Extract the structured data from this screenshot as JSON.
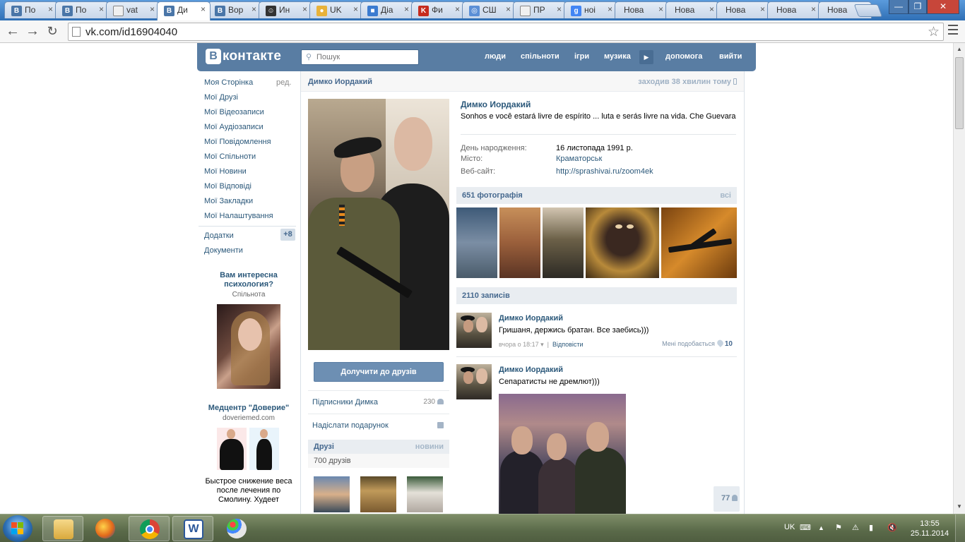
{
  "browser": {
    "tabs": [
      {
        "title": "По",
        "icon": "vk-icon"
      },
      {
        "title": "По",
        "icon": "vk-icon"
      },
      {
        "title": "vat",
        "icon": "page-icon"
      },
      {
        "title": "Ди",
        "icon": "vk-icon",
        "active": true
      },
      {
        "title": "Вор",
        "icon": "vk-icon"
      },
      {
        "title": "Ин",
        "icon": "user-icon"
      },
      {
        "title": "UK",
        "icon": "coin-icon"
      },
      {
        "title": "Діа",
        "icon": "chat-icon"
      },
      {
        "title": "Фи",
        "icon": "k-icon"
      },
      {
        "title": "СШ",
        "icon": "globe-icon"
      },
      {
        "title": "ПР",
        "icon": "page-icon"
      },
      {
        "title": "ноі",
        "icon": "google-icon"
      },
      {
        "title": "Нова",
        "icon": ""
      },
      {
        "title": "Нова",
        "icon": ""
      },
      {
        "title": "Нова",
        "icon": ""
      },
      {
        "title": "Нова",
        "icon": ""
      },
      {
        "title": "Нова",
        "icon": ""
      }
    ],
    "url": "vk.com/id16904040"
  },
  "vk": {
    "logo_letter": "B",
    "logo_text": "контакте",
    "search_placeholder": "Пошук",
    "nav": [
      "люди",
      "спільноти",
      "ігри",
      "музика",
      "допомога",
      "вийти"
    ],
    "left_menu": {
      "edit": "ред.",
      "items": [
        "Моя Сторінка",
        "Мої Друзі",
        "Мої Відеозаписи",
        "Мої Аудіозаписи",
        "Мої Повідомлення",
        "Мої Спільноти",
        "Мої Новини",
        "Мої Відповіді",
        "Мої Закладки",
        "Мої Налаштування"
      ],
      "extra": [
        "Додатки",
        "Документи"
      ],
      "apps_badge": "+8"
    },
    "ads": [
      {
        "title": "Вам интересна психология?",
        "subtitle": "Спільнота"
      },
      {
        "title": "Медцентр \"Доверие\"",
        "subtitle": "doveriemed.com",
        "text": "Быстрое снижение веса после лечения по Смолину. Худеет"
      }
    ],
    "profile": {
      "name": "Димко Иордакий",
      "last_seen": "заходив 38 хвилин тому",
      "status": "Sonhos e você estará livre de espírito ... luta e serás livre na vida. Che Guevara",
      "info": [
        {
          "label": "День народження:",
          "value": "16 листопада 1991 р."
        },
        {
          "label": "Місто:",
          "value": "Краматорськ"
        },
        {
          "label": "Веб-сайт:",
          "value": "http://sprashivai.ru/zoom4ek"
        }
      ],
      "add_friend": "Долучити до друзів",
      "followers_label": "Підписники Димка",
      "followers_count": "230",
      "send_gift": "Надіслати подарунок",
      "friends_title": "Друзі",
      "friends_updates": "новини",
      "friends_count": "700 друзів",
      "photos_title": "651 фотографія",
      "photos_all": "всі",
      "posts_title": "2110 записів"
    },
    "posts": [
      {
        "author": "Димко Иордакий",
        "text": "Гришаня, держись братан. Все заебись)))",
        "time": "вчора о 18:17",
        "reply": "Відповісти",
        "likes_label": "Мені подобається",
        "likes": "10"
      },
      {
        "author": "Димко Иордакий",
        "text": "Сепаратисты не дремлют)))"
      }
    ],
    "floater_count": "77"
  },
  "taskbar": {
    "lang": "UK",
    "time": "13:55",
    "date": "25.11.2014"
  }
}
